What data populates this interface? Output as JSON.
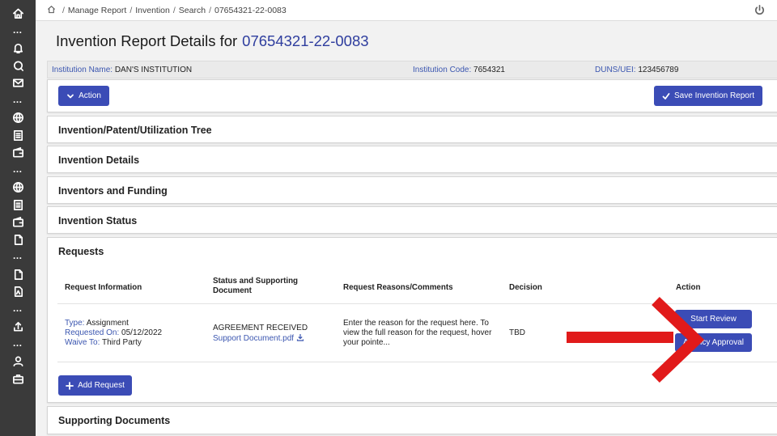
{
  "breadcrumb": [
    "Manage Report",
    "Invention",
    "Search",
    "07654321-22-0083"
  ],
  "page": {
    "title": "Invention Report Details for",
    "report_number": "07654321-22-0083"
  },
  "info": {
    "institution_name_label": "Institution Name:",
    "institution_name": "DAN'S INSTITUTION",
    "institution_code_label": "Institution Code:",
    "institution_code": "7654321",
    "duns_label": "DUNS/UEI:",
    "duns": "123456789"
  },
  "toolbar": {
    "action_label": "Action",
    "save_label": "Save Invention Report"
  },
  "sections": {
    "tree": "Invention/Patent/Utilization Tree",
    "details": "Invention Details",
    "inventors": "Inventors and Funding",
    "status": "Invention Status",
    "requests": "Requests",
    "supporting": "Supporting Documents"
  },
  "toggle": {
    "expand": "+",
    "collapse": "−"
  },
  "requests_table": {
    "columns": {
      "info": "Request Information",
      "status_line1": "Status and Supporting",
      "status_line2": "Document",
      "reasons": "Request Reasons/Comments",
      "decision": "Decision",
      "action": "Action"
    },
    "row": {
      "type_label": "Type:",
      "type": "Assignment",
      "requested_label": "Requested On:",
      "requested": "05/12/2022",
      "waive_label": "Waive To:",
      "waive": "Third Party",
      "status": "AGREEMENT RECEIVED",
      "document": "Support Document.pdf",
      "reason_line1": "Enter the reason for the request here. To",
      "reason_line2": "view the full reason for the request, hover",
      "reason_line3": "your pointe...",
      "decision": "TBD",
      "start_review": "Start Review",
      "agency_approval": "Agency Approval"
    },
    "add_request": "Add Request"
  },
  "colors": {
    "primary": "#3b4cb6",
    "link": "#3b56b0",
    "sidebar": "#3a3a3a",
    "annotation_arrow": "#e11a1a"
  },
  "icons": [
    "home-icon",
    "bell-icon",
    "chat-icon",
    "mail-icon",
    "globe-icon",
    "document-icon",
    "wallet-icon",
    "file-icon",
    "pdf-icon",
    "upload-icon",
    "user-icon",
    "briefcase-icon",
    "power-icon",
    "download-icon",
    "check-icon",
    "chevron-down-icon",
    "plus-icon"
  ]
}
